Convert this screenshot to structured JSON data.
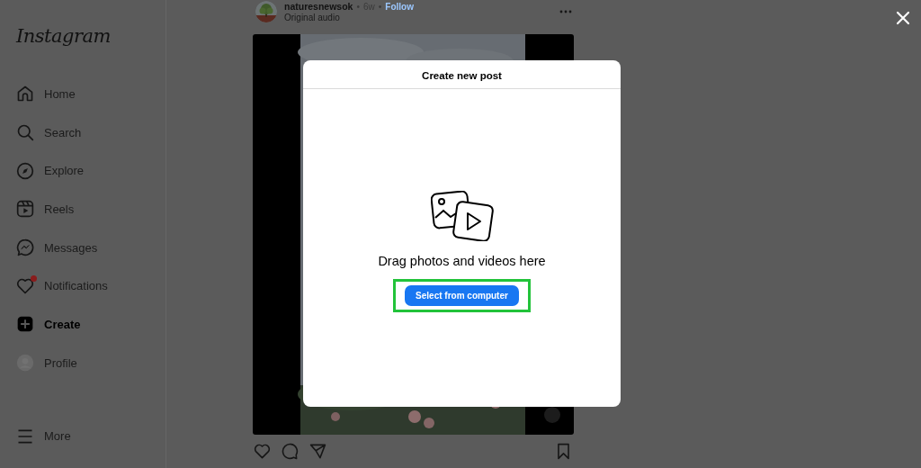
{
  "sidebar": {
    "logo": "Instagram",
    "items": [
      {
        "label": "Home",
        "kind": "home",
        "selected": false,
        "dot": false
      },
      {
        "label": "Search",
        "kind": "search",
        "selected": false,
        "dot": false
      },
      {
        "label": "Explore",
        "kind": "explore",
        "selected": false,
        "dot": false
      },
      {
        "label": "Reels",
        "kind": "reels",
        "selected": false,
        "dot": false
      },
      {
        "label": "Messages",
        "kind": "messages",
        "selected": false,
        "dot": false
      },
      {
        "label": "Notifications",
        "kind": "heart",
        "selected": false,
        "dot": true
      },
      {
        "label": "Create",
        "kind": "create",
        "selected": true,
        "dot": false
      },
      {
        "label": "Profile",
        "kind": "avatar",
        "selected": false,
        "dot": false
      }
    ],
    "more": {
      "label": "More"
    }
  },
  "post": {
    "username": "naturesnewsok",
    "separator": "•",
    "time": "6w",
    "follow": "Follow",
    "subtitle": "Original audio"
  },
  "dialog": {
    "title": "Create new post",
    "prompt": "Drag photos and videos here",
    "button": {
      "label": "Select from computer",
      "highlighted": true
    }
  }
}
